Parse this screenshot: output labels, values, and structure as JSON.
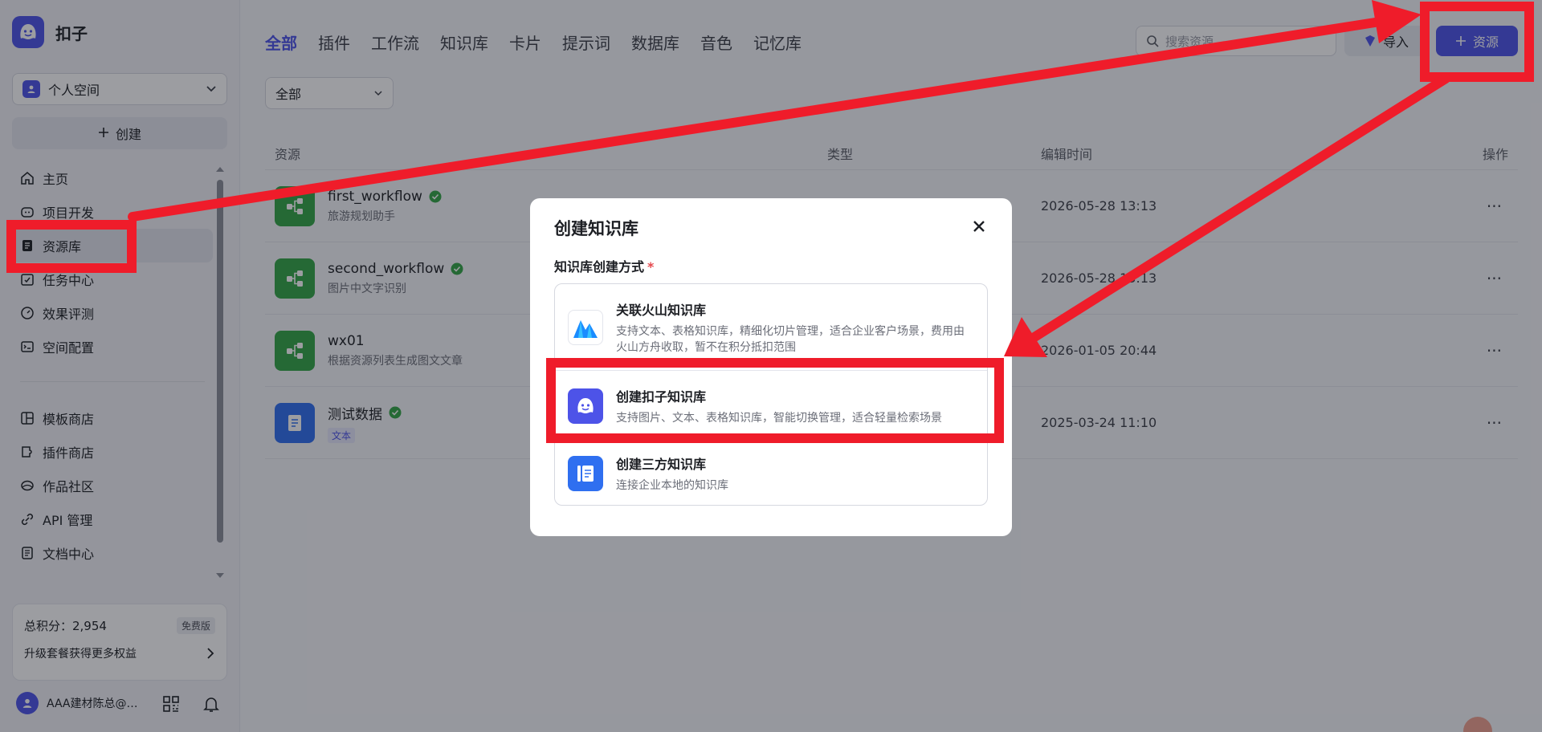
{
  "app": {
    "name": "扣子"
  },
  "sidebar": {
    "space": "个人空间",
    "create_label": "创建",
    "items": [
      {
        "label": "主页",
        "icon": "home-icon"
      },
      {
        "label": "项目开发",
        "icon": "robot-icon"
      },
      {
        "label": "资源库",
        "icon": "library-icon",
        "active": true
      },
      {
        "label": "任务中心",
        "icon": "task-icon"
      },
      {
        "label": "效果评测",
        "icon": "gauge-icon"
      },
      {
        "label": "空间配置",
        "icon": "config-icon"
      }
    ],
    "items2": [
      {
        "label": "模板商店",
        "icon": "template-icon"
      },
      {
        "label": "插件商店",
        "icon": "plugin-icon"
      },
      {
        "label": "作品社区",
        "icon": "community-icon"
      },
      {
        "label": "API 管理",
        "icon": "api-icon"
      },
      {
        "label": "文档中心",
        "icon": "doc-icon"
      }
    ],
    "points_label": "总积分：2,954",
    "plan_badge": "免费版",
    "upgrade_label": "升级套餐获得更多权益",
    "user_name": "AAA建材陈总@…"
  },
  "header": {
    "tabs": [
      "全部",
      "插件",
      "工作流",
      "知识库",
      "卡片",
      "提示词",
      "数据库",
      "音色",
      "记忆库"
    ],
    "search_placeholder": "搜索资源",
    "import_label": "导入",
    "resource_label": "资源"
  },
  "filter": {
    "value": "全部"
  },
  "table": {
    "columns": [
      "资源",
      "类型",
      "编辑时间",
      "操作"
    ],
    "rows": [
      {
        "name": "first_workflow",
        "desc": "旅游规划助手",
        "time": "2026-05-28 13:13",
        "verified": true,
        "kind": "workflow"
      },
      {
        "name": "second_workflow",
        "desc": "图片中文字识别",
        "time": "2026-05-28 13:13",
        "verified": true,
        "kind": "workflow"
      },
      {
        "name": "wx01",
        "desc": "根据资源列表生成图文文章",
        "time": "2026-01-05 20:44",
        "verified": false,
        "kind": "workflow"
      },
      {
        "name": "测试数据",
        "tag": "文本",
        "time": "2025-03-24 11:10",
        "verified": true,
        "kind": "knowledge"
      }
    ],
    "op_symbol": "···"
  },
  "modal": {
    "title": "创建知识库",
    "field_label": "知识库创建方式",
    "required_mark": "*",
    "options": [
      {
        "title": "关联火山知识库",
        "desc": "支持文本、表格知识库，精细化切片管理，适合企业客户场景，费用由火山方舟收取，暂不在积分抵扣范围",
        "icon": "volcano-icon"
      },
      {
        "title": "创建扣子知识库",
        "desc": "支持图片、文本、表格知识库，智能切换管理，适合轻量检索场景",
        "icon": "coze-icon"
      },
      {
        "title": "创建三方知识库",
        "desc": "连接企业本地的知识库",
        "icon": "third-party-icon"
      }
    ]
  },
  "colors": {
    "accent": "#4d53e8",
    "annotation": "#ef1c2a"
  }
}
